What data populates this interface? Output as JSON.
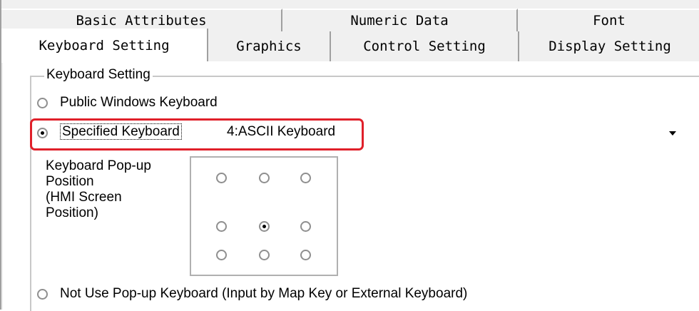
{
  "tabs": {
    "row1": [
      {
        "label": "Basic Attributes"
      },
      {
        "label": "Numeric Data"
      },
      {
        "label": "Font"
      }
    ],
    "row2": [
      {
        "label": "Keyboard Setting",
        "active": true
      },
      {
        "label": "Graphics"
      },
      {
        "label": "Control Setting"
      },
      {
        "label": "Display Setting"
      }
    ]
  },
  "group": {
    "title": "Keyboard Setting",
    "options": {
      "public": {
        "label": "Public Windows Keyboard",
        "selected": false
      },
      "specified": {
        "label": "Specified Keyboard",
        "selected": true
      },
      "none": {
        "label": "Not Use Pop-up Keyboard (Input by Map Key or External Keyboard)",
        "selected": false
      }
    },
    "keyboard_select": {
      "value": "4:ASCII Keyboard"
    },
    "popup_position": {
      "label_lines": [
        "Keyboard Pop-up",
        "Position",
        "(HMI Screen",
        "Position)"
      ],
      "selected_cell": "middle-center"
    }
  },
  "colors": {
    "highlight": "#e0202a",
    "tab_bg": "#f0f0f0",
    "panel_bg": "#ffffff"
  }
}
